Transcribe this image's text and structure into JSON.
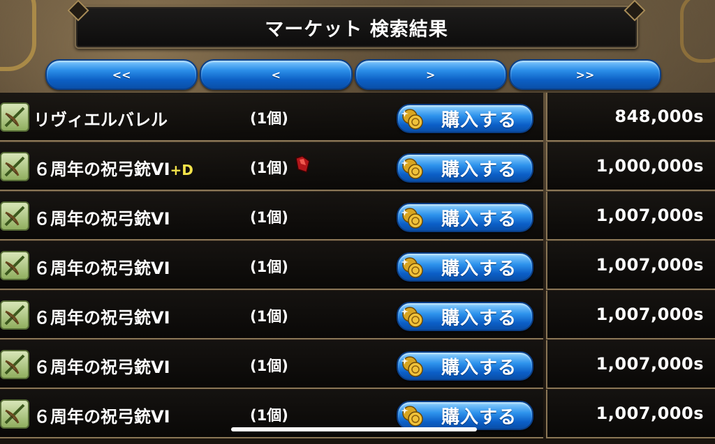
{
  "header": {
    "title": "マーケット 検索結果"
  },
  "pager": {
    "first": "<<",
    "prev": "<",
    "next": ">",
    "last": ">>"
  },
  "buy_label": "購入する",
  "rows": [
    {
      "name": "リヴィエルバレル",
      "plus": "",
      "qty": "(1個)",
      "price": "848,000s"
    },
    {
      "name": "６周年の祝弓銃VI",
      "plus": "+D",
      "qty": "(1個)",
      "price": "1,000,000s"
    },
    {
      "name": "６周年の祝弓銃VI",
      "plus": "",
      "qty": "(1個)",
      "price": "1,007,000s"
    },
    {
      "name": "６周年の祝弓銃VI",
      "plus": "",
      "qty": "(1個)",
      "price": "1,007,000s"
    },
    {
      "name": "６周年の祝弓銃VI",
      "plus": "",
      "qty": "(1個)",
      "price": "1,007,000s"
    },
    {
      "name": "６周年の祝弓銃VI",
      "plus": "",
      "qty": "(1個)",
      "price": "1,007,000s"
    },
    {
      "name": "６周年の祝弓銃VI",
      "plus": "",
      "qty": "(1個)",
      "price": "1,007,000s"
    }
  ],
  "icons": {
    "item": "crossbow-icon",
    "buy": "coins-icon",
    "element": "fire-gem-icon"
  },
  "colors": {
    "button_blue": "#0c5fc4",
    "plus_yellow": "#f3e34a",
    "border_gold": "#8a7656"
  }
}
